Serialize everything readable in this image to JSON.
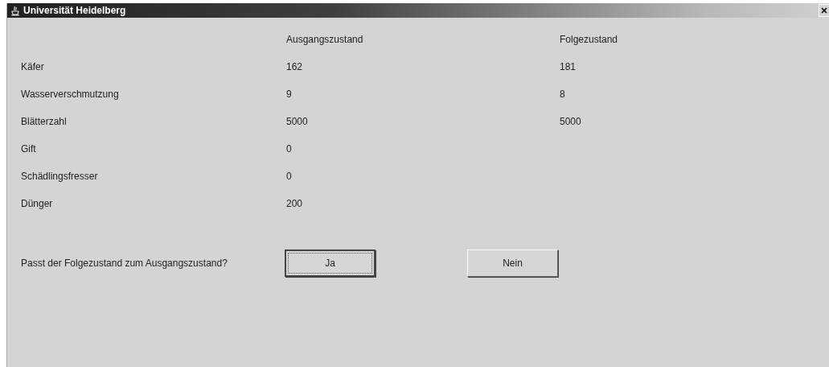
{
  "window": {
    "title": "Universität Heidelberg"
  },
  "table": {
    "columns": [
      "Ausgangszustand",
      "Folgezustand"
    ],
    "rows": [
      {
        "label": "Käfer",
        "values": [
          "162",
          "181"
        ]
      },
      {
        "label": "Wasserverschmutzung",
        "values": [
          "9",
          "8"
        ]
      },
      {
        "label": "Blätterzahl",
        "values": [
          "5000",
          "5000"
        ]
      },
      {
        "label": "Gift",
        "values": [
          "0"
        ]
      },
      {
        "label": "Schädlingsfresser",
        "values": [
          "0"
        ]
      },
      {
        "label": "Dünger",
        "values": [
          "200"
        ]
      }
    ]
  },
  "question": "Passt der Folgezustand zum Ausgangszustand?",
  "buttons": [
    {
      "label": "Ja",
      "focused": true
    },
    {
      "label": "Nein",
      "focused": false
    }
  ]
}
